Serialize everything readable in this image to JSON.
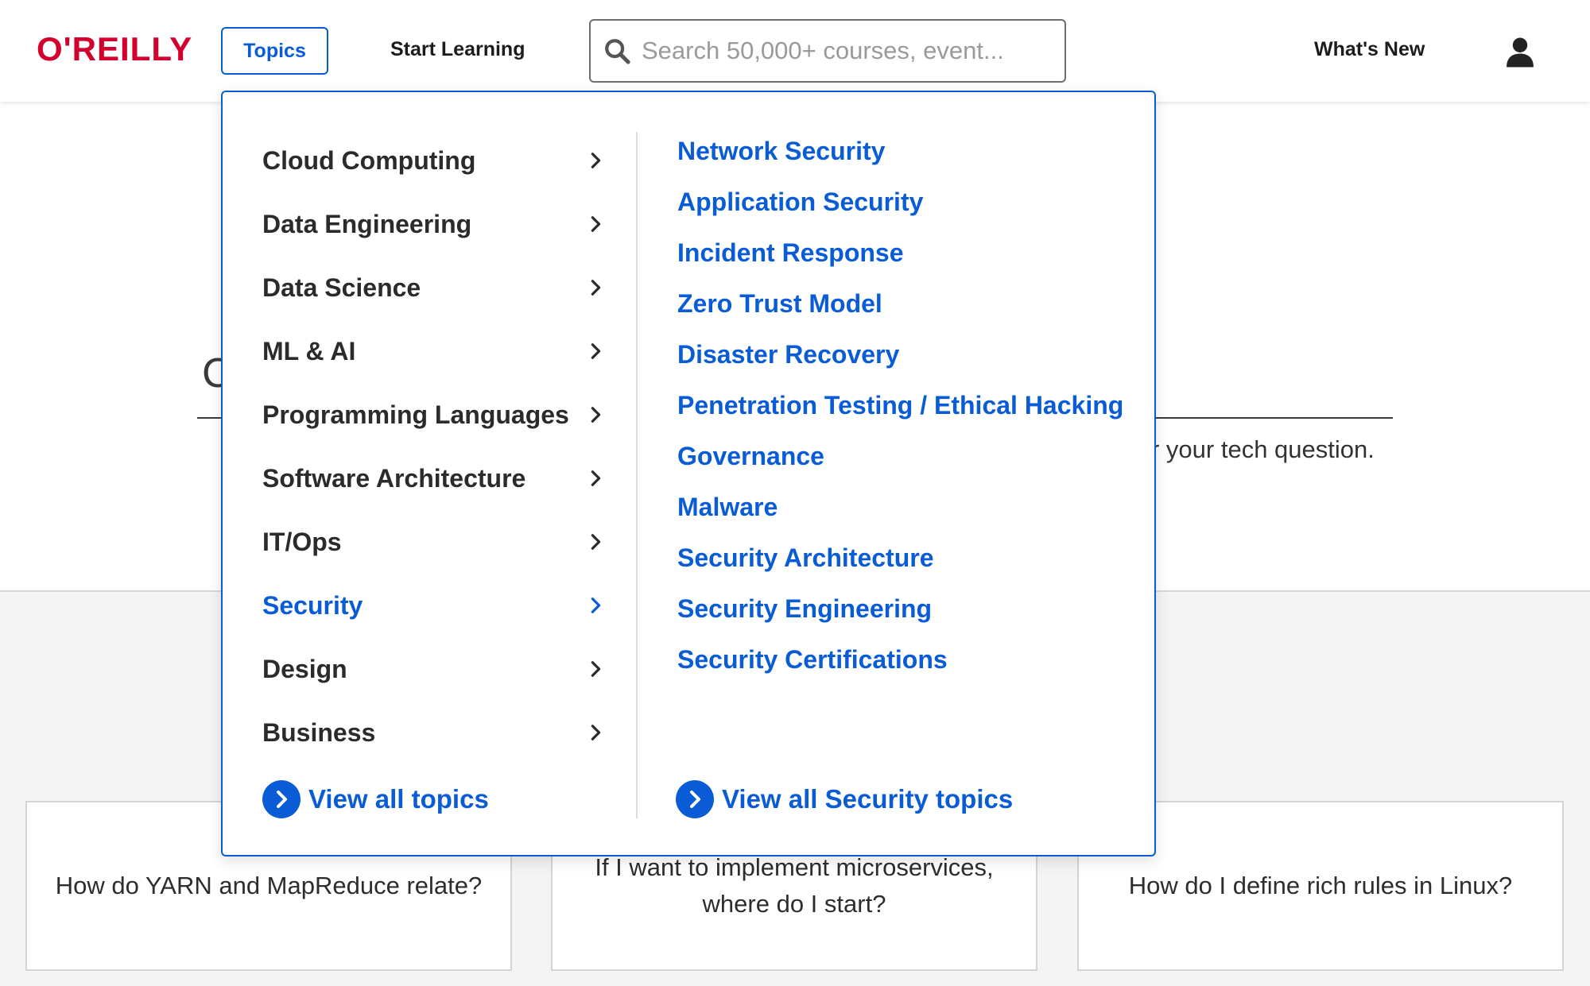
{
  "header": {
    "logo": "O'REILLY",
    "topics_button": "Topics",
    "start_learning": "Start Learning",
    "search_placeholder": "Search 50,000+ courses, event...",
    "whats_new": "What's New"
  },
  "background": {
    "heading_fragment": "C",
    "subtext_fragment": "r your tech question.",
    "questions": [
      "How do YARN and MapReduce relate?",
      "If I want to implement microservices, where do I start?",
      "How do I define rich rules in Linux?"
    ]
  },
  "dropdown": {
    "categories": [
      {
        "label": "Cloud Computing",
        "active": false
      },
      {
        "label": "Data Engineering",
        "active": false
      },
      {
        "label": "Data Science",
        "active": false
      },
      {
        "label": "ML & AI",
        "active": false
      },
      {
        "label": "Programming Languages",
        "active": false
      },
      {
        "label": "Software Architecture",
        "active": false
      },
      {
        "label": "IT/Ops",
        "active": false
      },
      {
        "label": "Security",
        "active": true
      },
      {
        "label": "Design",
        "active": false
      },
      {
        "label": "Business",
        "active": false
      }
    ],
    "subtopics": [
      "Network Security",
      "Application Security",
      "Incident Response",
      "Zero Trust Model",
      "Disaster Recovery",
      "Penetration Testing / Ethical Hacking",
      "Governance",
      "Malware",
      "Security Architecture",
      "Security Engineering",
      "Security Certifications"
    ],
    "view_all_topics": "View all topics",
    "view_all_section": "View all Security topics"
  },
  "colors": {
    "accent": "#0a5cd6",
    "brand": "#d3002d"
  },
  "icons": {
    "search": "search-icon",
    "user": "user-icon",
    "chevron": "chevron-right-icon",
    "circle_chevron": "circle-chevron-right-icon"
  }
}
